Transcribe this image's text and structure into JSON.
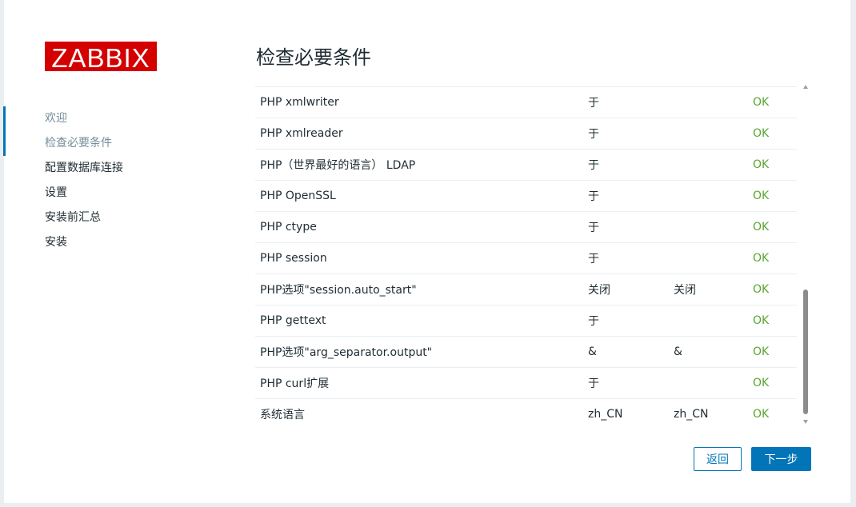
{
  "logo": "ZABBIX",
  "title": "检查必要条件",
  "steps": [
    {
      "label": "欢迎",
      "state": "done"
    },
    {
      "label": "检查必要条件",
      "state": "current"
    },
    {
      "label": "配置数据库连接",
      "state": "pending"
    },
    {
      "label": "设置",
      "state": "pending"
    },
    {
      "label": "安装前汇总",
      "state": "pending"
    },
    {
      "label": "安装",
      "state": "pending"
    }
  ],
  "requirements": [
    {
      "name": "PHP xmlwriter",
      "current": "于",
      "required": "",
      "status": "OK"
    },
    {
      "name": "PHP xmlreader",
      "current": "于",
      "required": "",
      "status": "OK"
    },
    {
      "name": "PHP（世界最好的语言） LDAP",
      "current": "于",
      "required": "",
      "status": "OK"
    },
    {
      "name": "PHP OpenSSL",
      "current": "于",
      "required": "",
      "status": "OK"
    },
    {
      "name": "PHP ctype",
      "current": "于",
      "required": "",
      "status": "OK"
    },
    {
      "name": "PHP session",
      "current": "于",
      "required": "",
      "status": "OK"
    },
    {
      "name": "PHP选项\"session.auto_start\"",
      "current": "关闭",
      "required": "关闭",
      "status": "OK"
    },
    {
      "name": "PHP gettext",
      "current": "于",
      "required": "",
      "status": "OK"
    },
    {
      "name": "PHP选项\"arg_separator.output\"",
      "current": "&",
      "required": "&",
      "status": "OK"
    },
    {
      "name": "PHP curl扩展",
      "current": "于",
      "required": "",
      "status": "OK"
    },
    {
      "name": "系统语言",
      "current": "zh_CN",
      "required": "zh_CN",
      "status": "OK"
    }
  ],
  "buttons": {
    "back": "返回",
    "next": "下一步"
  },
  "colors": {
    "brand": "#d40000",
    "accent": "#0275b8",
    "ok": "#59a42f"
  }
}
